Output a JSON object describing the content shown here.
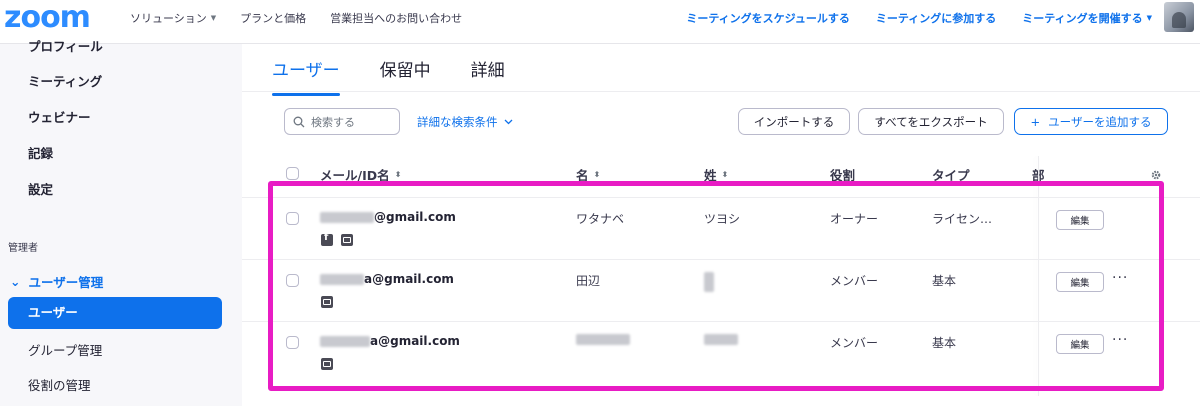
{
  "topbar": {
    "logo": "zoom",
    "nav_left": [
      {
        "label": "ソリューション",
        "has_caret": true
      },
      {
        "label": "プランと価格",
        "has_caret": false
      },
      {
        "label": "営業担当へのお問い合わせ",
        "has_caret": false
      }
    ],
    "nav_right": [
      {
        "label": "ミーティングをスケジュールする",
        "has_caret": false
      },
      {
        "label": "ミーティングに参加する",
        "has_caret": false
      },
      {
        "label": "ミーティングを開催する",
        "has_caret": true
      }
    ],
    "caret_glyph": "▼"
  },
  "sidebar": {
    "items": [
      "プロフィール",
      "ミーティング",
      "ウェビナー",
      "記録",
      "設定"
    ],
    "section_label": "管理者",
    "group_label": "ユーザー管理",
    "group_chevron": "⌄",
    "active_item": "ユーザー",
    "sub_items": [
      "グループ管理",
      "役割の管理"
    ]
  },
  "main": {
    "tabs": [
      {
        "label": "ユーザー",
        "active": true
      },
      {
        "label": "保留中",
        "active": false
      },
      {
        "label": "詳細",
        "active": false
      }
    ],
    "search_placeholder": "検索する",
    "advanced_search": "詳細な検索条件",
    "buttons": {
      "import": "インポートする",
      "export": "すべてをエクスポート",
      "add_plus": "+",
      "add": "ユーザーを追加する"
    },
    "columns": {
      "email": "メール/ID名",
      "first_name": "名",
      "last_name": "姓",
      "role": "役割",
      "type": "タイプ",
      "dept": "部"
    },
    "sort_glyph": "⬍",
    "rows": [
      {
        "email": "@gmail.com",
        "first_name": "ワタナベ",
        "last_name": "ツヨシ",
        "role": "オーナー",
        "type": "ライセン…",
        "edit": "編集",
        "icons": [
          "facebook-icon",
          "mail-icon"
        ],
        "show_more": false
      },
      {
        "email": "a@gmail.com",
        "first_name": "田辺",
        "last_name": "",
        "role": "メンバー",
        "type": "基本",
        "edit": "編集",
        "icons": [
          "mail-icon"
        ],
        "show_more": true
      },
      {
        "email": "a@gmail.com",
        "first_name": "",
        "last_name": "",
        "role": "メンバー",
        "type": "基本",
        "edit": "編集",
        "icons": [
          "mail-icon"
        ],
        "show_more": true
      }
    ],
    "more_glyph": "···"
  },
  "colors": {
    "accent": "#0E71EB",
    "logo": "#2D8CFF",
    "highlight": "#E81CC4",
    "sidebar_bg": "#f7f7fa"
  }
}
